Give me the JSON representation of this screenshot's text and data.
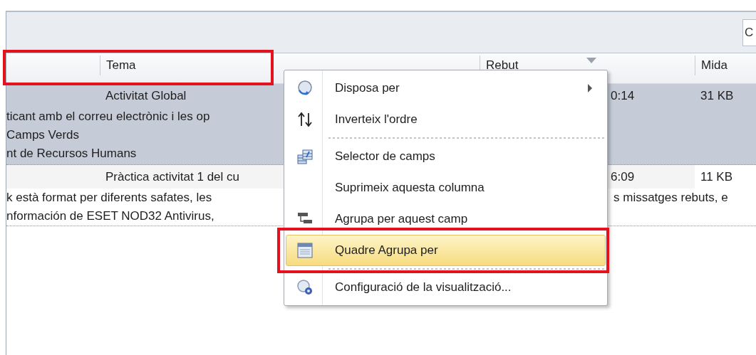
{
  "toolbar": {
    "search": {
      "value": "C"
    }
  },
  "columns": [
    {
      "label": "Tema",
      "annotated": true,
      "sorted": false
    },
    {
      "label": "Rebut",
      "annotated": false,
      "sorted": true
    },
    {
      "label": "Mida",
      "annotated": false,
      "sorted": false
    }
  ],
  "messages": [
    {
      "selected": true,
      "subject": "Activitat Global",
      "received": "0:14",
      "size": "31 KB",
      "preview": [
        {
          "text": "ticant amb el correu electrònic i les op"
        },
        {
          "text": "Camps Verds"
        },
        {
          "text": "nt de Recursos Humans"
        }
      ]
    },
    {
      "selected": false,
      "subject": "Pràctica activitat 1 del cu",
      "received": "6:09",
      "size": "11 KB",
      "preview": [
        {
          "text": "k està format per diferents safates, les",
          "after_menu": "s missatges rebuts, e"
        },
        {
          "text": "nformación de ESET NOD32 Antivirus,"
        }
      ]
    }
  ],
  "context_menu": {
    "items": [
      {
        "kind": "item",
        "label": "Disposa per",
        "submenu": true,
        "selected": false,
        "annotated": false
      },
      {
        "kind": "item",
        "label": "Inverteix l'ordre",
        "submenu": false,
        "selected": false,
        "annotated": false
      },
      {
        "kind": "separator"
      },
      {
        "kind": "item",
        "label": "Selector de camps",
        "submenu": false,
        "selected": false,
        "annotated": false
      },
      {
        "kind": "item",
        "label": "Suprimeix aquesta columna",
        "submenu": false,
        "selected": false,
        "annotated": false
      },
      {
        "kind": "item",
        "label": "Agrupa per aquest camp",
        "submenu": false,
        "selected": false,
        "annotated": false
      },
      {
        "kind": "item",
        "label": "Quadre Agrupa per",
        "submenu": false,
        "selected": true,
        "annotated": true
      },
      {
        "kind": "separator"
      },
      {
        "kind": "item",
        "label": "Configuració de la visualització...",
        "submenu": false,
        "selected": false,
        "annotated": false
      }
    ]
  }
}
